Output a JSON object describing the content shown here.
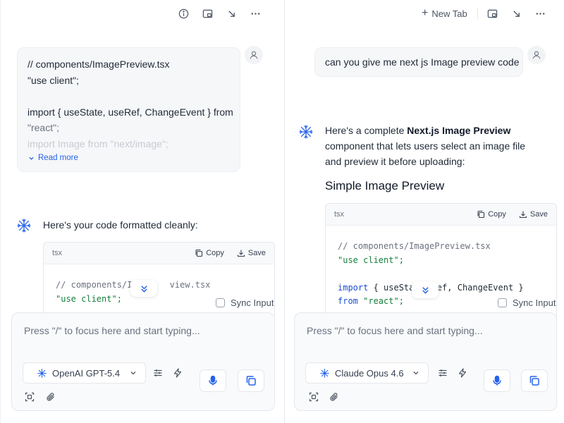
{
  "colors": {
    "accent": "#2563eb",
    "code_string": "#15803d",
    "code_keyword": "#1d4ed8",
    "code_comment": "#6b7280"
  },
  "left": {
    "toolbar": {
      "icons": [
        "info-icon",
        "picture-in-picture-icon",
        "minimize-arrow-icon",
        "more-icon"
      ]
    },
    "user_message": {
      "lines": [
        "// components/ImagePreview.tsx",
        "\"use client\";",
        "",
        "import { useState, useRef, ChangeEvent } from",
        "\"react\";",
        "import Image from \"next/image\";"
      ],
      "read_more": "Read more"
    },
    "assistant": {
      "text": "Here's your code formatted cleanly:"
    },
    "code_block": {
      "lang": "tsx",
      "copy": "Copy",
      "save": "Save",
      "line1_pre": "// components/Im",
      "line1_post": "view.tsx",
      "line2": "\"use client\";"
    },
    "sync_input": "Sync Input",
    "composer": {
      "placeholder": "Press \"/\" to focus here and start typing...",
      "model": "OpenAI GPT-5.4"
    }
  },
  "right": {
    "toolbar": {
      "new_tab": "New Tab",
      "icons": [
        "picture-in-picture-icon",
        "minimize-arrow-icon",
        "more-icon"
      ]
    },
    "user_message": {
      "text": "can you give me next js Image preview code"
    },
    "assistant": {
      "text_before": "Here's a complete ",
      "text_bold": "Next.js Image Preview",
      "text_after": " component that lets users select an image file and preview it before uploading:",
      "heading": "Simple Image Preview"
    },
    "code_block": {
      "lang": "tsx",
      "copy": "Copy",
      "save": "Save",
      "line1": "// components/ImagePreview.tsx",
      "line2": "\"use client\";",
      "line3_kw": "import",
      "line3_pre": " { useStat",
      "line3_post": "Ref, ChangeEvent }",
      "line4_kw": "from",
      "line4_str": " \"react\";"
    },
    "sync_input": "Sync Input",
    "composer": {
      "placeholder": "Press \"/\" to focus here and start typing...",
      "model": "Claude Opus 4.6"
    }
  }
}
